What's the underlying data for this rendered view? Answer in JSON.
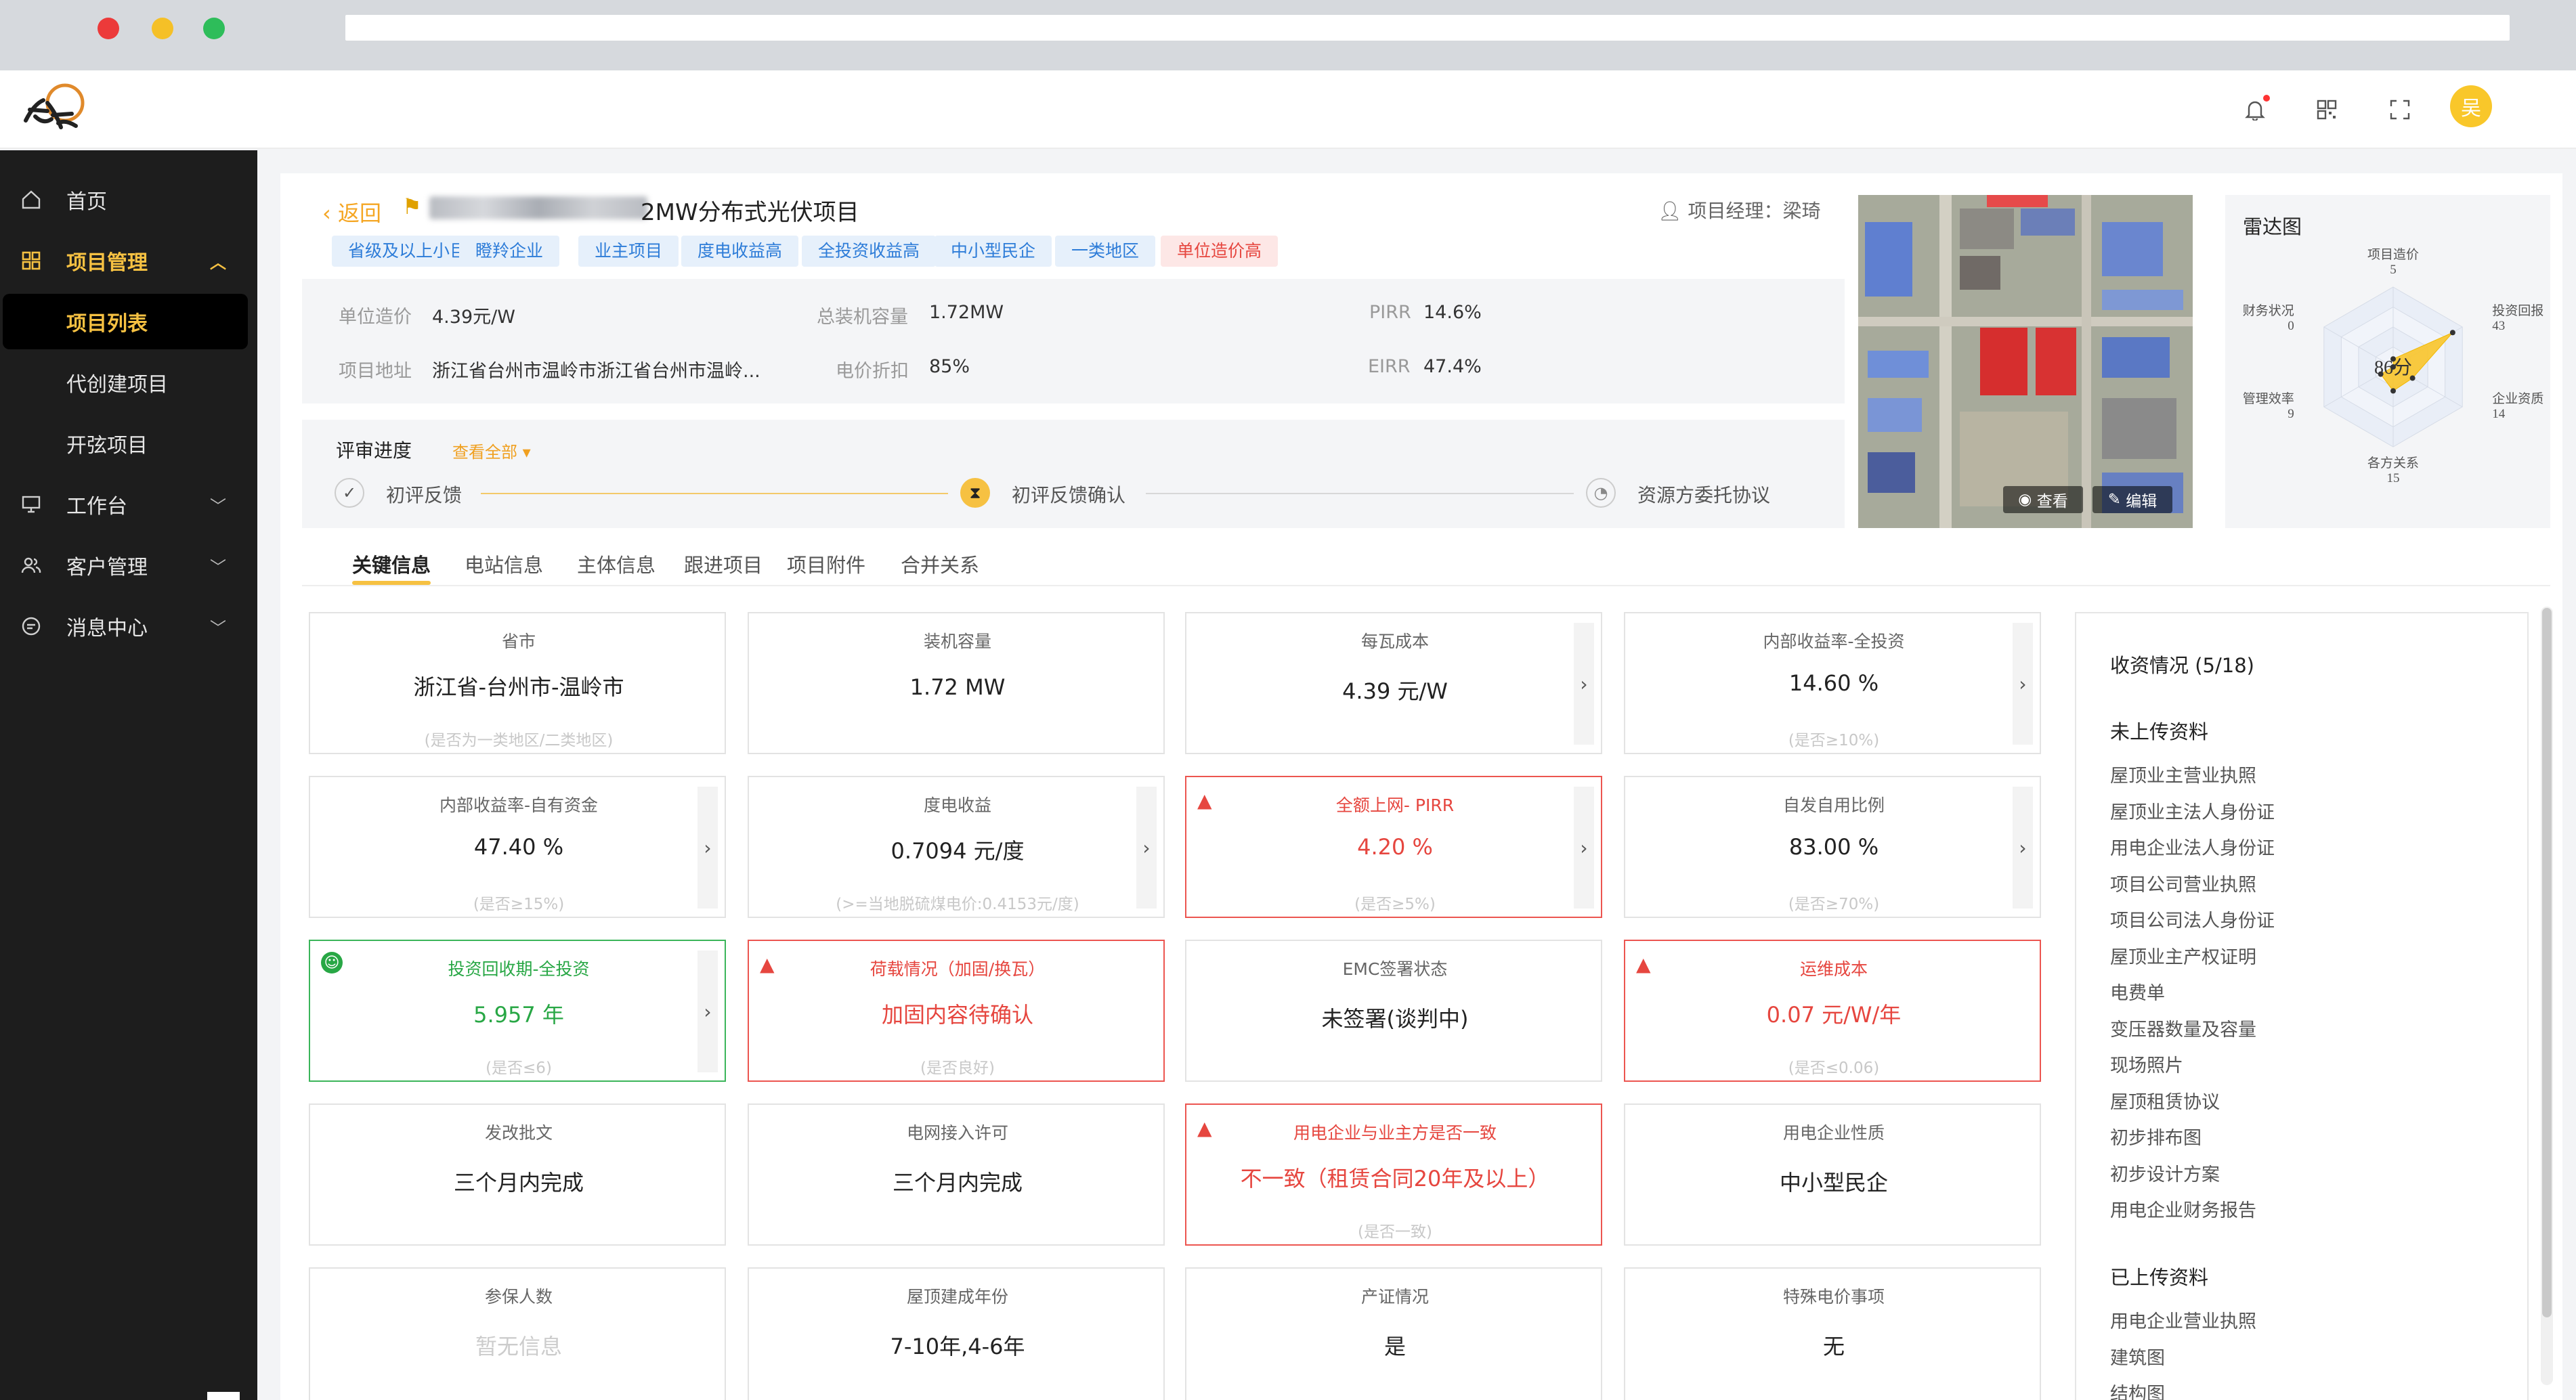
{
  "sidebar": {
    "home": "首页",
    "project_mgmt": "项目管理",
    "project_list": "项目列表",
    "proxy_create": "代创建项目",
    "kaixian": "开弦项目",
    "workbench": "工作台",
    "customer": "客户管理",
    "messages": "消息中心"
  },
  "header": {
    "avatar_text": "吴"
  },
  "project": {
    "back_label": "返回",
    "title": "2MW分布式光伏项目",
    "manager_label": "项目经理：",
    "manager_name": "梁琦",
    "tags": [
      {
        "text": "省级及以上小巨人",
        "type": "blue"
      },
      {
        "text": "瞪羚企业",
        "type": "blue"
      },
      {
        "text": "业主项目",
        "type": "blue"
      },
      {
        "text": "度电收益高",
        "type": "blue"
      },
      {
        "text": "全投资收益高",
        "type": "blue"
      },
      {
        "text": "中小型民企",
        "type": "blue"
      },
      {
        "text": "一类地区",
        "type": "blue"
      },
      {
        "text": "单位造价高",
        "type": "red"
      }
    ]
  },
  "info": {
    "unit_cost_label": "单位造价",
    "unit_cost": "4.39元/W",
    "capacity_label": "总装机容量",
    "capacity": "1.72MW",
    "pirr_label": "PIRR",
    "pirr": "14.6%",
    "address_label": "项目地址",
    "address": "浙江省台州市温岭市浙江省台州市温岭...",
    "discount_label": "电价折扣",
    "discount": "85%",
    "eirr_label": "EIRR",
    "eirr": "47.4%"
  },
  "progress": {
    "title": "评审进度",
    "view_all": "查看全部",
    "steps": [
      "初评反馈",
      "初评反馈确认",
      "资源方委托协议"
    ]
  },
  "map": {
    "view_label": "查看",
    "edit_label": "编辑"
  },
  "radar": {
    "title": "雷达图",
    "score": "86分",
    "axes": [
      {
        "name": "项目造价",
        "value": 5
      },
      {
        "name": "投资回报",
        "value": 43
      },
      {
        "name": "企业资质",
        "value": 14
      },
      {
        "name": "各方关系",
        "value": 15
      },
      {
        "name": "管理效率",
        "value": 9
      },
      {
        "name": "财务状况",
        "value": 0
      }
    ]
  },
  "tabs": [
    "关键信息",
    "电站信息",
    "主体信息",
    "跟进项目",
    "项目附件",
    "合并关系"
  ],
  "cards": [
    {
      "title": "省市",
      "value": "浙江省-台州市-温岭市",
      "sub": "(是否为一类地区/二类地区)",
      "status": "normal",
      "arrow": false
    },
    {
      "title": "装机容量",
      "value": "1.72 MW",
      "sub": "",
      "status": "normal",
      "arrow": false
    },
    {
      "title": "每瓦成本",
      "value": "4.39 元/W",
      "sub": "",
      "status": "normal",
      "arrow": true
    },
    {
      "title": "内部收益率-全投资",
      "value": "14.60 %",
      "sub": "(是否≥10%)",
      "status": "normal",
      "arrow": true
    },
    {
      "title": "内部收益率-自有资金",
      "value": "47.40 %",
      "sub": "(是否≥15%)",
      "status": "normal",
      "arrow": true
    },
    {
      "title": "度电收益",
      "value": "0.7094 元/度",
      "sub": "(>=当地脱硫煤电价:0.4153元/度)",
      "status": "normal",
      "arrow": true
    },
    {
      "title": "全额上网- PIRR",
      "value": "4.20 %",
      "sub": "(是否≥5%)",
      "status": "red",
      "arrow": true
    },
    {
      "title": "自发自用比例",
      "value": "83.00 %",
      "sub": "(是否≥70%)",
      "status": "normal",
      "arrow": true
    },
    {
      "title": "投资回收期-全投资",
      "value": "5.957 年",
      "sub": "(是否≤6)",
      "status": "green",
      "arrow": true
    },
    {
      "title": "荷载情况（加固/换瓦）",
      "value": "加固内容待确认",
      "sub": "(是否良好)",
      "status": "red",
      "arrow": false
    },
    {
      "title": "EMC签署状态",
      "value": "未签署(谈判中)",
      "sub": "",
      "status": "normal",
      "arrow": false
    },
    {
      "title": "运维成本",
      "value": "0.07 元/W/年",
      "sub": "(是否≤0.06)",
      "status": "red",
      "arrow": false
    },
    {
      "title": "发改批文",
      "value": "三个月内完成",
      "sub": "",
      "status": "normal",
      "arrow": false
    },
    {
      "title": "电网接入许可",
      "value": "三个月内完成",
      "sub": "",
      "status": "normal",
      "arrow": false
    },
    {
      "title": "用电企业与业主方是否一致",
      "value": "不一致（租赁合同20年及以上）",
      "sub": "(是否一致)",
      "status": "red",
      "arrow": false
    },
    {
      "title": "用电企业性质",
      "value": "中小型民企",
      "sub": "",
      "status": "normal",
      "arrow": false
    },
    {
      "title": "参保人数",
      "value": "暂无信息",
      "sub": "",
      "status": "muted",
      "arrow": false
    },
    {
      "title": "屋顶建成年份",
      "value": "7-10年,4-6年",
      "sub": "",
      "status": "normal",
      "arrow": false
    },
    {
      "title": "产证情况",
      "value": "是",
      "sub": "",
      "status": "normal",
      "arrow": false
    },
    {
      "title": "特殊电价事项",
      "value": "无",
      "sub": "",
      "status": "normal",
      "arrow": false
    }
  ],
  "materials": {
    "title": "收资情况 (5/18)",
    "not_uploaded_title": "未上传资料",
    "not_uploaded": [
      "屋顶业主营业执照",
      "屋顶业主法人身份证",
      "用电企业法人身份证",
      "项目公司营业执照",
      "项目公司法人身份证",
      "屋顶业主产权证明",
      "电费单",
      "变压器数量及容量",
      "现场照片",
      "屋顶租赁协议",
      "初步排布图",
      "初步设计方案",
      "用电企业财务报告"
    ],
    "uploaded_title": "已上传资料",
    "uploaded": [
      "用电企业营业执照",
      "建筑图",
      "结构图"
    ]
  },
  "colors": {
    "accent": "#f6c142",
    "danger": "#e6463f",
    "success": "#28a745",
    "tag_blue": "#2d7cd8"
  }
}
